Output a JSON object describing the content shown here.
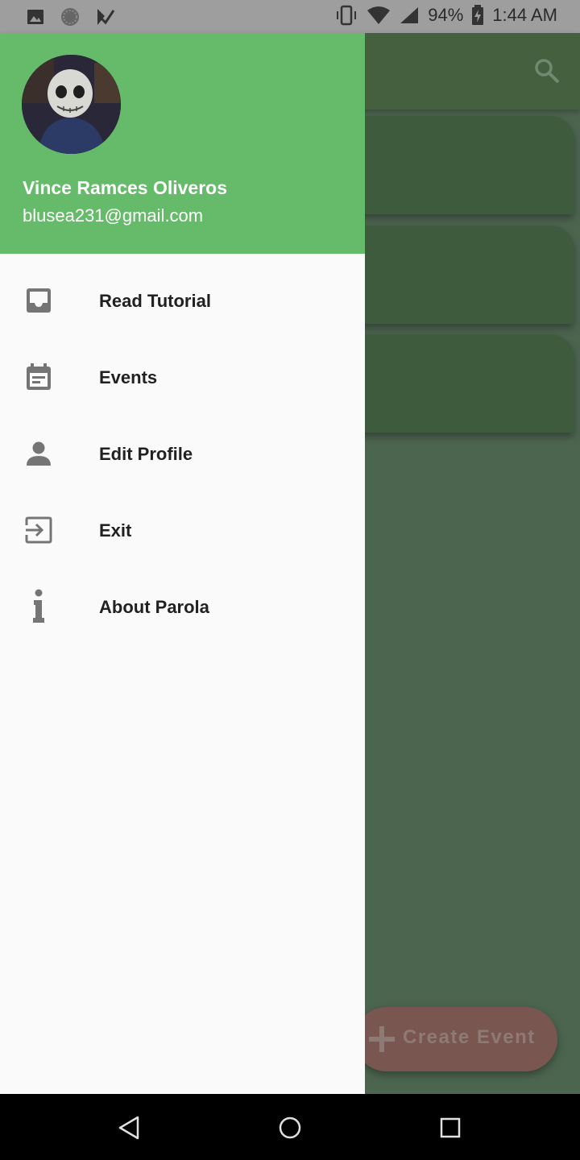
{
  "status_bar": {
    "battery": "94%",
    "time": "1:44 AM",
    "left_icons": [
      "image-icon",
      "sync-icon",
      "play-store-icon"
    ],
    "right_icons": [
      "vibrate-icon",
      "wifi-icon",
      "signal-icon",
      "battery-charging-icon"
    ]
  },
  "background_app": {
    "search_icon": "search-icon",
    "fab_label": "Create Event",
    "fab_icon": "plus-icon",
    "colors": {
      "appbar": "#44603f",
      "card": "#3e5c3d",
      "fab": "#7a5651"
    }
  },
  "drawer": {
    "header": {
      "name": "Vince Ramces Oliveros",
      "email": "blusea231@gmail.com",
      "background": "#66bb6a"
    },
    "items": [
      {
        "label": "Read Tutorial",
        "icon": "inbox-icon"
      },
      {
        "label": "Events",
        "icon": "calendar-icon"
      },
      {
        "label": "Edit Profile",
        "icon": "person-icon"
      },
      {
        "label": "Exit",
        "icon": "exit-icon"
      },
      {
        "label": "About Parola",
        "icon": "info-icon"
      }
    ]
  },
  "nav_bar": {
    "buttons": [
      "back-icon",
      "home-icon",
      "recents-icon"
    ]
  }
}
